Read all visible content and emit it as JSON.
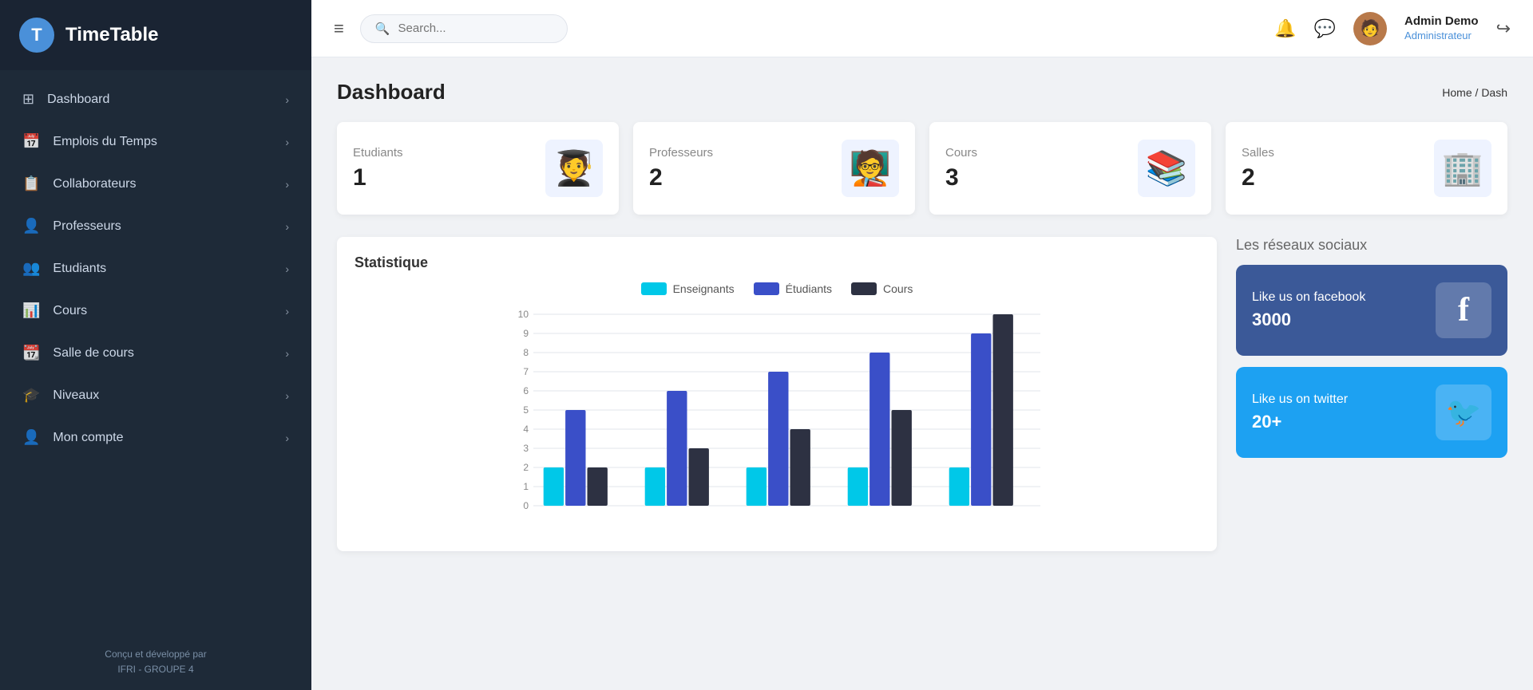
{
  "app": {
    "logo_letter": "T",
    "title": "TimeTable"
  },
  "sidebar": {
    "items": [
      {
        "id": "dashboard",
        "label": "Dashboard",
        "icon": "⊞"
      },
      {
        "id": "emplois",
        "label": "Emplois du Temps",
        "icon": "📅"
      },
      {
        "id": "collaborateurs",
        "label": "Collaborateurs",
        "icon": "📋"
      },
      {
        "id": "professeurs",
        "label": "Professeurs",
        "icon": "👤"
      },
      {
        "id": "etudiants",
        "label": "Etudiants",
        "icon": "👥"
      },
      {
        "id": "cours",
        "label": "Cours",
        "icon": "📊"
      },
      {
        "id": "salle",
        "label": "Salle de cours",
        "icon": "📆"
      },
      {
        "id": "niveaux",
        "label": "Niveaux",
        "icon": "🎓"
      },
      {
        "id": "compte",
        "label": "Mon compte",
        "icon": "👤"
      }
    ],
    "footer_line1": "Conçu et développé par",
    "footer_line2": "IFRI - GROUPE 4"
  },
  "topbar": {
    "menu_icon": "≡",
    "search_placeholder": "Search...",
    "user_name": "Admin Demo",
    "user_role": "Administrateur",
    "user_emoji": "🧑"
  },
  "page": {
    "title": "Dashboard",
    "breadcrumb_home": "Home",
    "breadcrumb_sep": "/",
    "breadcrumb_current": "Dash"
  },
  "stats": [
    {
      "label": "Etudiants",
      "value": "1",
      "emoji": "🧑‍🎓"
    },
    {
      "label": "Professeurs",
      "value": "2",
      "emoji": "🧑‍🏫"
    },
    {
      "label": "Cours",
      "value": "3",
      "emoji": "📚"
    },
    {
      "label": "Salles",
      "value": "2",
      "emoji": "🏢"
    }
  ],
  "chart": {
    "title": "Statistique",
    "legend": [
      {
        "label": "Enseignants",
        "color": "#00c8e8"
      },
      {
        "label": "Étudiants",
        "color": "#3a4fc8"
      },
      {
        "label": "Cours",
        "color": "#2d3142"
      }
    ],
    "y_max": 10,
    "groups": [
      {
        "x_label": "",
        "enseignants": 2,
        "etudiants": 5,
        "cours": 2
      },
      {
        "x_label": "",
        "enseignants": 2,
        "etudiants": 6,
        "cours": 3
      },
      {
        "x_label": "",
        "enseignants": 2,
        "etudiants": 7,
        "cours": 4
      },
      {
        "x_label": "",
        "enseignants": 2,
        "etudiants": 8,
        "cours": 5
      },
      {
        "x_label": "",
        "enseignants": 2,
        "etudiants": 9,
        "cours": 10
      }
    ]
  },
  "social": {
    "section_title": "Les réseaux sociaux",
    "cards": [
      {
        "id": "facebook",
        "name": "Like us on facebook",
        "count": "3000",
        "icon": "f",
        "color_class": "facebook"
      },
      {
        "id": "twitter",
        "name": "Like us on twitter",
        "count": "20+",
        "icon": "🐦",
        "color_class": "twitter"
      }
    ]
  }
}
